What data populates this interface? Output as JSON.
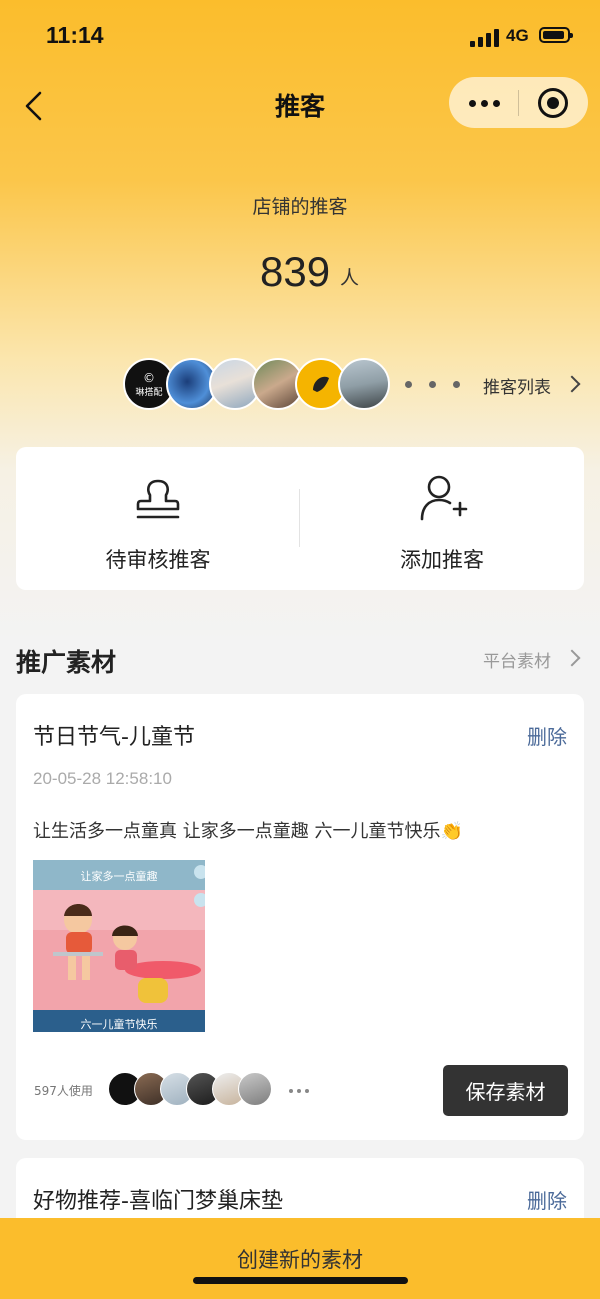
{
  "status_bar": {
    "time": "11:14",
    "network": "4G"
  },
  "nav": {
    "title": "推客"
  },
  "stats": {
    "label": "店铺的推客",
    "count": "839",
    "unit": "人"
  },
  "promoters": {
    "first_avatar_text": "©\n琳搭配",
    "list_link": "推客列表"
  },
  "actions": [
    {
      "label": "待审核推客",
      "icon": "stamp-icon"
    },
    {
      "label": "添加推客",
      "icon": "add-user-icon"
    }
  ],
  "section": {
    "title": "推广素材",
    "link": "平台素材"
  },
  "materials": [
    {
      "title": "节日节气-儿童节",
      "delete_label": "删除",
      "time": "20-05-28 12:58:10",
      "text": "让生活多一点童真 让家多一点童趣 六一儿童节快乐👏",
      "image_top_text": "让家多一点童趣",
      "image_bottom_text": "六一儿童节快乐",
      "uses": "597人使用",
      "save_label": "保存素材"
    },
    {
      "title": "好物推荐-喜临门梦巢床垫",
      "delete_label": "删除"
    }
  ],
  "bottom": {
    "create_label": "创建新的素材"
  },
  "colors": {
    "accent": "#fbbd2c",
    "link": "#4b6a99",
    "button": "#333333"
  }
}
